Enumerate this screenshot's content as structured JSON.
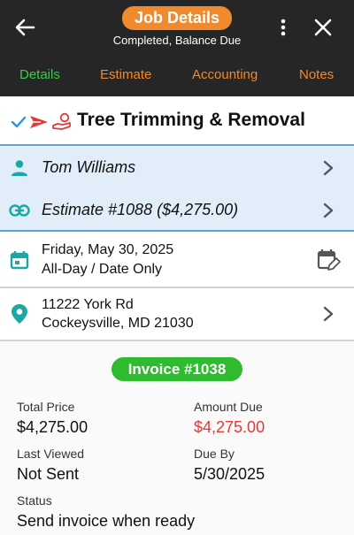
{
  "header": {
    "title": "Job Details",
    "subtitle": "Completed, Balance Due",
    "back_icon": "arrow-left-icon",
    "more_icon": "more-vertical-icon",
    "close_icon": "close-icon"
  },
  "tabs": [
    {
      "label": "Details",
      "active": true
    },
    {
      "label": "Estimate",
      "active": false
    },
    {
      "label": "Accounting",
      "active": false
    },
    {
      "label": "Notes",
      "active": false
    }
  ],
  "job": {
    "title": "Tree Trimming & Removal",
    "status_icons": [
      "checkmark-icon",
      "paper-plane-icon",
      "hand-payment-icon"
    ]
  },
  "customer": {
    "name": "Tom Williams"
  },
  "estimate": {
    "label": "Estimate #1088 ($4,275.00)"
  },
  "schedule": {
    "date": "Friday, May 30, 2025",
    "time": "All-Day / Date Only"
  },
  "address": {
    "line1": "11222 York Rd",
    "line2": "Cockeysville, MD 21030"
  },
  "invoice": {
    "title": "Invoice #1038",
    "total_price_label": "Total Price",
    "total_price": "$4,275.00",
    "amount_due_label": "Amount Due",
    "amount_due": "$4,275.00",
    "last_viewed_label": "Last Viewed",
    "last_viewed": "Not Sent",
    "due_by_label": "Due By",
    "due_by": "5/30/2025",
    "status_label": "Status",
    "status": "Send invoice when ready"
  },
  "colors": {
    "header_bg": "#262626",
    "accent_orange": "#f08a2c",
    "active_green": "#3dc94a",
    "teal_icon": "#1aa7a5",
    "invoice_green": "#2fbb2f",
    "due_red": "#e53935",
    "section_blue": "#e1eefa"
  }
}
